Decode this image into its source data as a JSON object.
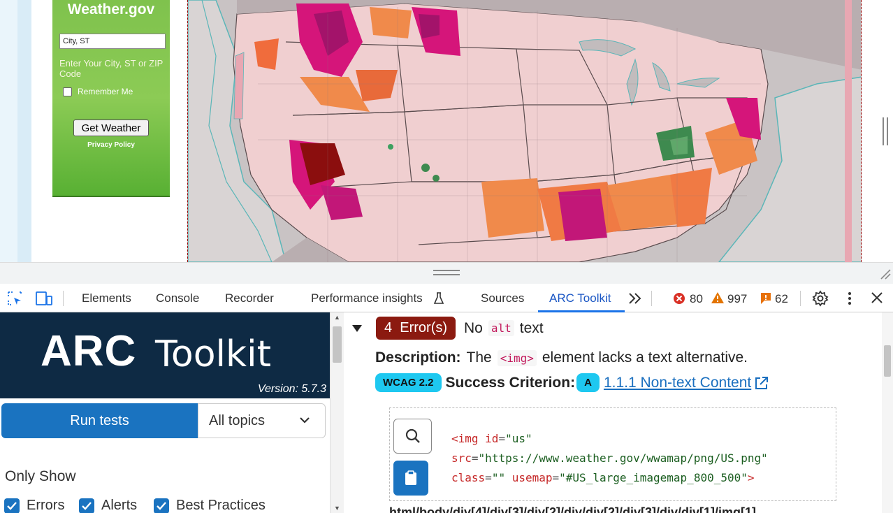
{
  "webpage": {
    "widget": {
      "title": "Weather.gov",
      "city_value": "City, ST",
      "hint": "Enter Your City, ST or ZIP Code",
      "remember_label": "Remember Me",
      "button_label": "Get Weather",
      "privacy_label": "Privacy Policy"
    }
  },
  "devtools": {
    "tabs": [
      {
        "label": "Elements"
      },
      {
        "label": "Console"
      },
      {
        "label": "Recorder"
      },
      {
        "label": "Performance insights"
      },
      {
        "label": "Sources"
      },
      {
        "label": "ARC Toolkit"
      }
    ],
    "active_tab": "ARC Toolkit",
    "error_count": "80",
    "warning_count": "997",
    "issue_count": "62"
  },
  "arc": {
    "logo_main": "ARC",
    "logo_sub": "Toolkit",
    "version": "Version: 5.7.3",
    "run_tests_label": "Run tests",
    "topics_value": "All topics",
    "only_show_label": "Only Show",
    "filters": [
      {
        "label": "Errors",
        "checked": true
      },
      {
        "label": "Alerts",
        "checked": true
      },
      {
        "label": "Best Practices",
        "checked": true
      }
    ],
    "result": {
      "count_badge": "4",
      "badge_suffix": "Error(s)",
      "title_prefix": "No",
      "title_code": "alt",
      "title_suffix": "text",
      "description_label": "Description:",
      "description_pre": "The",
      "description_code": "<img>",
      "description_post": "element lacks a text alternative.",
      "wcag_pill": "WCAG 2.2",
      "criterion_label": "Success Criterion:",
      "level_pill": "A",
      "criterion_link": "1.1.1 Non-text Content",
      "code": {
        "tag": "<img",
        "id_attr": "id",
        "id_val": "\"us\"",
        "src_attr": "src",
        "src_val": "\"https://www.weather.gov/wwamap/png/US.png\"",
        "class_attr": "class",
        "class_val": "\"\"",
        "usemap_attr": "usemap",
        "usemap_val": "\"#US_large_imagemap_800_500\"",
        "close": ">"
      },
      "xpath": "html/body/div[4]/div[3]/div[2]/div/div[2]/div[3]/div/div[1]/img[1]"
    }
  },
  "colors": {
    "arc_navy": "#0e2a44",
    "primary_blue": "#1a73c0",
    "error_red": "#8b1a10",
    "wcag_cyan": "#1ec8f0"
  }
}
